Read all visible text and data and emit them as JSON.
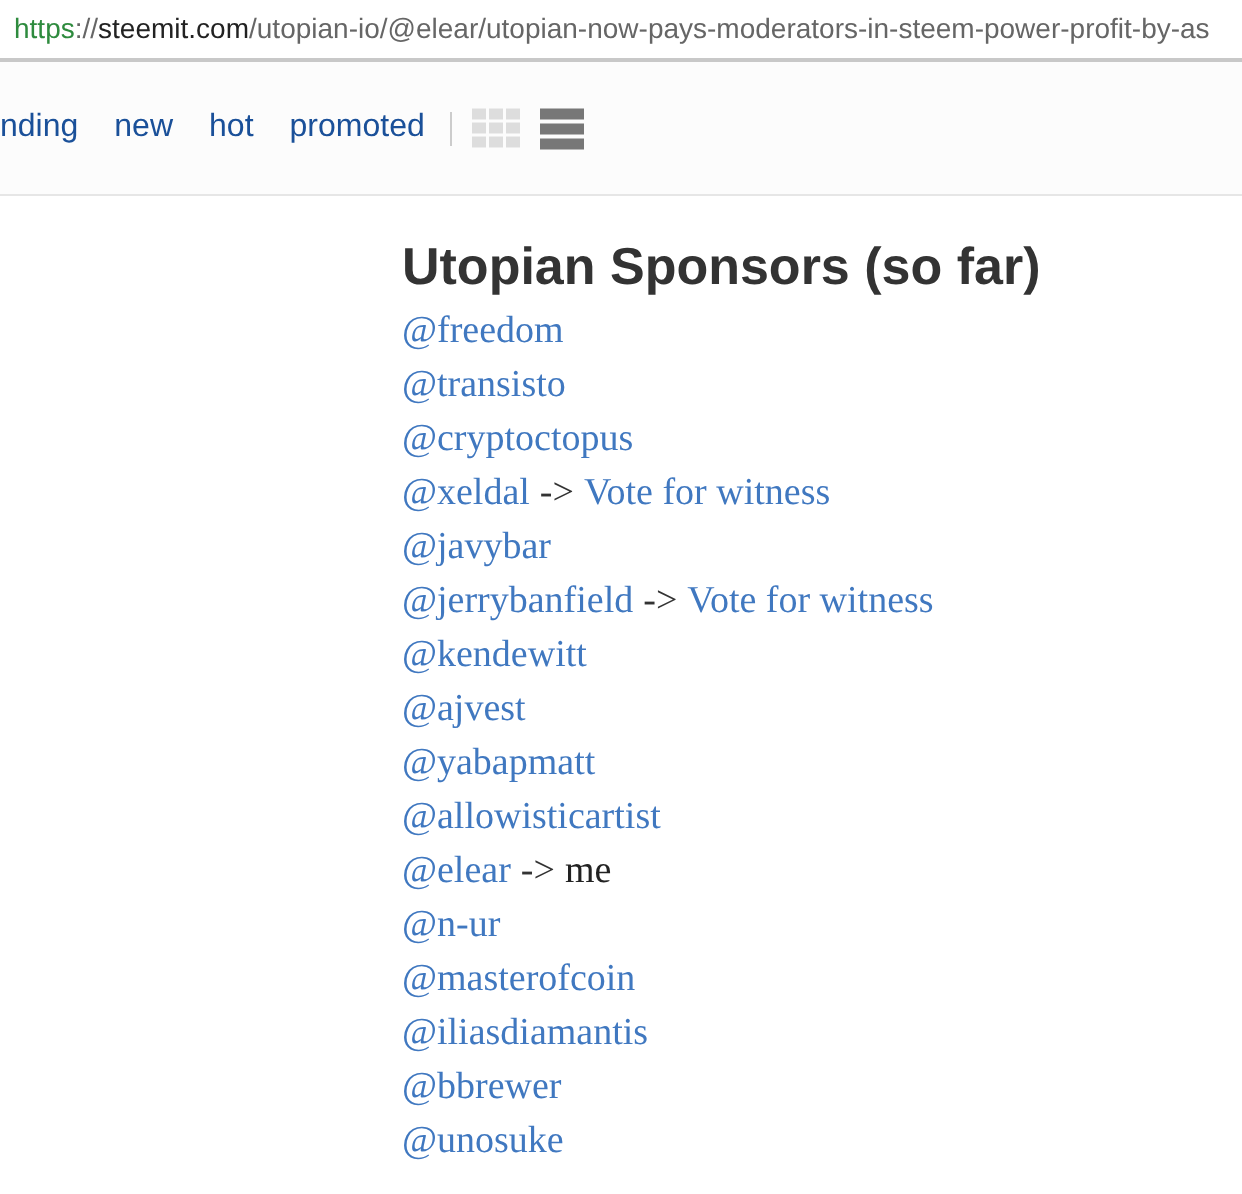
{
  "address_bar": {
    "scheme": "https",
    "separator": "://",
    "host": "steemit.com",
    "path": "/utopian-io/@elear/utopian-now-pays-moderators-in-steem-power-profit-by-as"
  },
  "nav": {
    "links": [
      {
        "label": "nding"
      },
      {
        "label": "new"
      },
      {
        "label": "hot"
      },
      {
        "label": "promoted"
      }
    ],
    "views": [
      {
        "kind": "grid",
        "selected": false
      },
      {
        "kind": "list",
        "selected": true
      }
    ]
  },
  "article": {
    "heading": "Utopian Sponsors (so far)",
    "sponsors": [
      {
        "name": "@freedom"
      },
      {
        "name": "@transisto"
      },
      {
        "name": "@cryptoctopus"
      },
      {
        "name": "@xeldal",
        "arrow": "->",
        "note": "Vote for witness",
        "kind": "link"
      },
      {
        "name": "@javybar"
      },
      {
        "name": "@jerrybanfield",
        "arrow": "->",
        "note": "Vote for witness",
        "kind": "link"
      },
      {
        "name": "@kendewitt"
      },
      {
        "name": "@ajvest"
      },
      {
        "name": "@yabapmatt"
      },
      {
        "name": "@allowisticartist"
      },
      {
        "name": "@elear",
        "arrow": "->",
        "note": "me",
        "kind": "text"
      },
      {
        "name": "@n-ur"
      },
      {
        "name": "@masterofcoin"
      },
      {
        "name": "@iliasdiamantis"
      },
      {
        "name": "@bbrewer"
      },
      {
        "name": "@unosuke"
      }
    ]
  }
}
